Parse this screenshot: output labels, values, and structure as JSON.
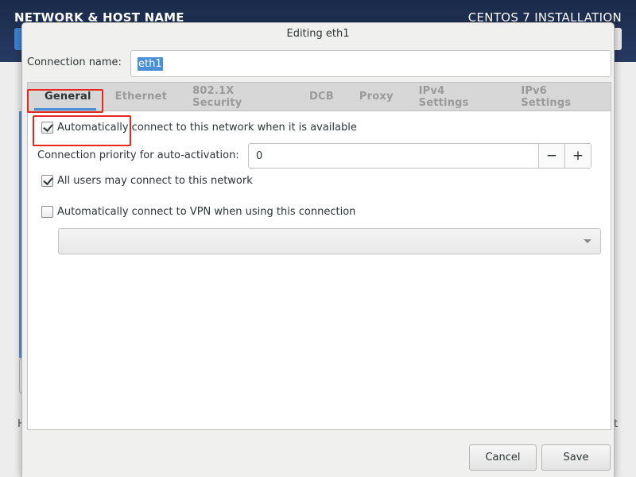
{
  "background": {
    "section_title": "NETWORK & HOST NAME",
    "installer_title": "CENTOS 7 INSTALLATION",
    "left_fragment": "H",
    "right_fragment": "t"
  },
  "dialog": {
    "title": "Editing eth1",
    "connection_name_label": "Connection name:",
    "connection_name_value": "eth1",
    "tabs": [
      {
        "label": "General",
        "active": true
      },
      {
        "label": "Ethernet",
        "active": false
      },
      {
        "label": "802.1X Security",
        "active": false
      },
      {
        "label": "DCB",
        "active": false
      },
      {
        "label": "Proxy",
        "active": false
      },
      {
        "label": "IPv4 Settings",
        "active": false
      },
      {
        "label": "IPv6 Settings",
        "active": false
      }
    ],
    "general": {
      "auto_connect": {
        "label": "Automatically connect to this network when it is available",
        "checked": true
      },
      "priority_label": "Connection priority for auto-activation:",
      "priority_value": "0",
      "minus": "−",
      "plus": "+",
      "all_users": {
        "label": "All users may connect to this network",
        "checked": true
      },
      "auto_vpn": {
        "label": "Automatically connect to VPN when using this connection",
        "checked": false
      },
      "vpn_selected": ""
    },
    "buttons": {
      "cancel": "Cancel",
      "save": "Save"
    }
  },
  "colors": {
    "accent": "#4a90d9",
    "annotation": "#e8271d",
    "header": "#1a2a4a"
  }
}
